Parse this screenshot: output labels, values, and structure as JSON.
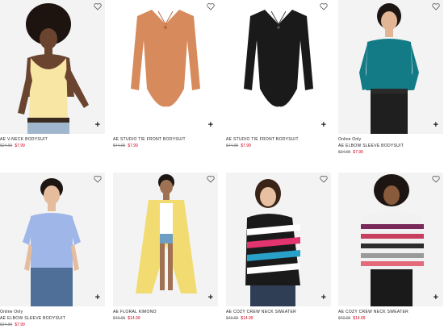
{
  "products": [
    {
      "online": "",
      "name": "AE V-NECK BODYSUIT",
      "orig_price": "$24.95",
      "sale_price": "$7.99"
    },
    {
      "online": "",
      "name": "AE STUDIO TIE FRONT BODYSUIT",
      "orig_price": "$44.95",
      "sale_price": "$7.99"
    },
    {
      "online": "",
      "name": "AE STUDIO TIE FRONT BODYSUIT",
      "orig_price": "$44.95",
      "sale_price": "$7.99"
    },
    {
      "online": "Online Only",
      "name": "AE ELBOW SLEEVE BODYSUIT",
      "orig_price": "$24.95",
      "sale_price": "$7.99"
    },
    {
      "online": "",
      "name": "AE ELBOW SLEEVE BODYSUIT",
      "orig_price": "$24.95",
      "sale_price": "$7.99"
    },
    {
      "online": "",
      "name": "AE FLORAL KIMONO",
      "orig_price": "$49.95",
      "sale_price": "$14.99"
    },
    {
      "online": "",
      "name": "AE COZY CREW NECK SWEATER",
      "orig_price": "$49.95",
      "sale_price": "$14.99"
    },
    {
      "online": "",
      "name": "AE COZY CREW NECK SWEATER",
      "orig_price": "$49.95",
      "sale_price": "$14.99"
    }
  ],
  "product_lower_0": {
    "online": "Online Only"
  },
  "icons": {
    "favorite": "heart-icon",
    "add": "plus-icon"
  },
  "add_glyph": "+",
  "colors": {
    "sale": "#d0021b",
    "original": "#888888",
    "text": "#222222"
  }
}
